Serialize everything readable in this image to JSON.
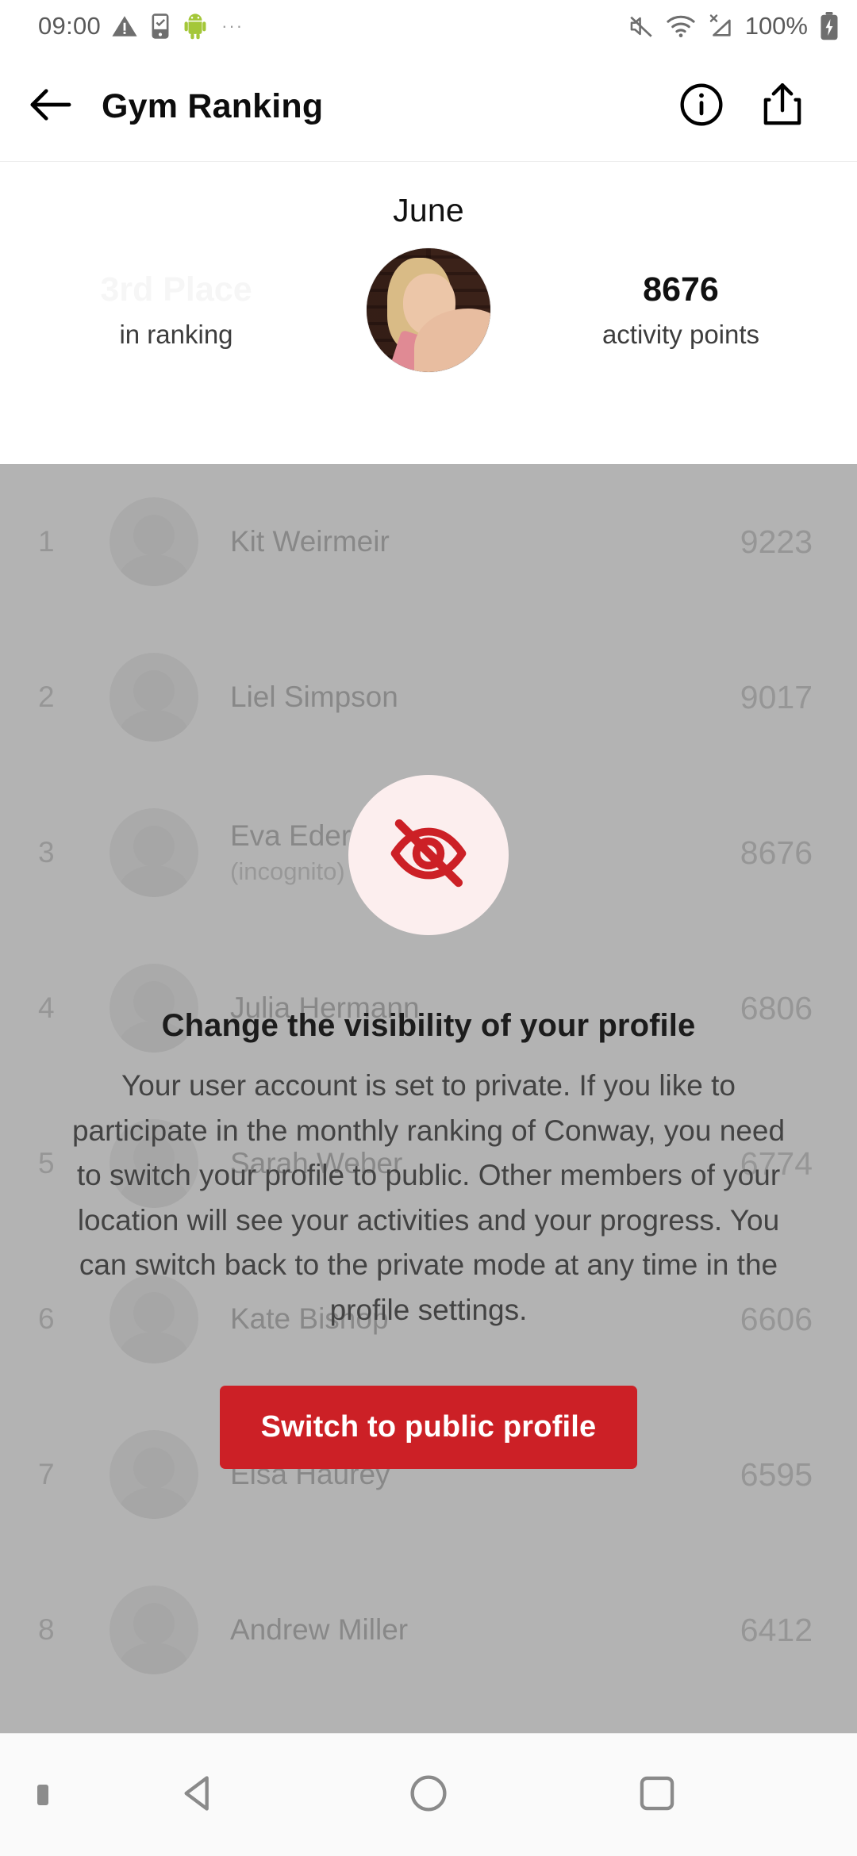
{
  "status_bar": {
    "time": "09:00",
    "overflow": "···",
    "battery_percent": "100%",
    "icons": [
      "warning-icon",
      "phone-check-icon",
      "android-icon",
      "overflow-dots-icon",
      "mute-icon",
      "wifi-icon",
      "signal-no-service-icon",
      "battery-charging-icon"
    ]
  },
  "app_bar": {
    "back_label": "back-arrow",
    "title": "Gym Ranking",
    "info_label": "info",
    "share_label": "share"
  },
  "summary": {
    "month": "June",
    "rank_value": "3rd Place",
    "rank_caption": "in ranking",
    "points_value": "8676",
    "points_caption": "activity points"
  },
  "ranking": {
    "rows": [
      {
        "rank": "1",
        "name": "Kit Weirmeir",
        "note": "",
        "points": "9223"
      },
      {
        "rank": "2",
        "name": "Liel Simpson",
        "note": "",
        "points": "9017"
      },
      {
        "rank": "3",
        "name": "Eva Ederer",
        "note": "(incognito)",
        "points": "8676"
      },
      {
        "rank": "4",
        "name": "Julia Hermann",
        "note": "",
        "points": "6806"
      },
      {
        "rank": "5",
        "name": "Sarah Weber",
        "note": "",
        "points": "6774"
      },
      {
        "rank": "6",
        "name": "Kate Bishop",
        "note": "",
        "points": "6606"
      },
      {
        "rank": "7",
        "name": "Elsa Haurey",
        "note": "",
        "points": "6595"
      },
      {
        "rank": "8",
        "name": "Andrew Miller",
        "note": "",
        "points": "6412"
      }
    ]
  },
  "overlay": {
    "icon": "eye-off-icon",
    "title": "Change the visibility of your profile",
    "body": "Your user account is set to private. If you like to participate in the monthly ranking of Conway, you need to switch your profile to public. Other members of your location will see your activities and your progress. You can switch back to the private mode at any time in the profile settings.",
    "button_label": "Switch to public profile"
  },
  "nav_bar": {
    "back": "nav-back",
    "home": "nav-home",
    "recents": "nav-recents"
  },
  "colors": {
    "accent_red": "#cc2026",
    "icon_bg_pink": "#fceeee",
    "scrim": "#b0b0b0",
    "text_primary": "#1c1c1c",
    "text_secondary": "#434343"
  }
}
